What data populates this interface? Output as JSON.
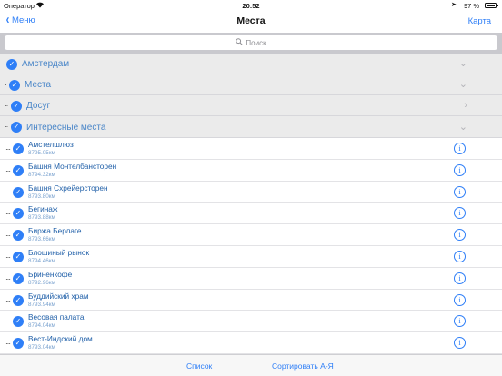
{
  "status_bar": {
    "carrier": "Оператор",
    "time": "20:52",
    "battery": "97 %"
  },
  "nav": {
    "back_label": "Меню",
    "title": "Места",
    "right_label": "Карта"
  },
  "search": {
    "placeholder": "Поиск"
  },
  "groups": [
    {
      "label": "Амстердам",
      "chevron": "chevron-down-icon"
    },
    {
      "label": "Места",
      "chevron": "chevron-down-icon"
    },
    {
      "label": "Досуг",
      "chevron": "chevron-right-icon"
    },
    {
      "label": "Интересные места",
      "chevron": "chevron-down-icon"
    }
  ],
  "items": [
    {
      "name": "Амстелшлюз",
      "distance": "8795.05км"
    },
    {
      "name": "Башня Монтелбансторен",
      "distance": "8794.32км"
    },
    {
      "name": "Башня Схрейерсторен",
      "distance": "8793.80км"
    },
    {
      "name": "Бегинаж",
      "distance": "8793.88км"
    },
    {
      "name": "Биржа Берлаге",
      "distance": "8793.66км"
    },
    {
      "name": "Блошиный рынок",
      "distance": "8794.46км"
    },
    {
      "name": "Бриненкофе",
      "distance": "8792.96км"
    },
    {
      "name": "Буддийский храм",
      "distance": "8793.94км"
    },
    {
      "name": "Весовая палата",
      "distance": "8794.04км"
    },
    {
      "name": "Вест-Индский дом",
      "distance": "8793.04км"
    }
  ],
  "toolbar": {
    "list_label": "Список",
    "sort_label": "Сортировать А-Я"
  },
  "colors": {
    "accent": "#2f7ff7",
    "group_background": "#ebebeb",
    "search_background": "#c9c9ce"
  }
}
